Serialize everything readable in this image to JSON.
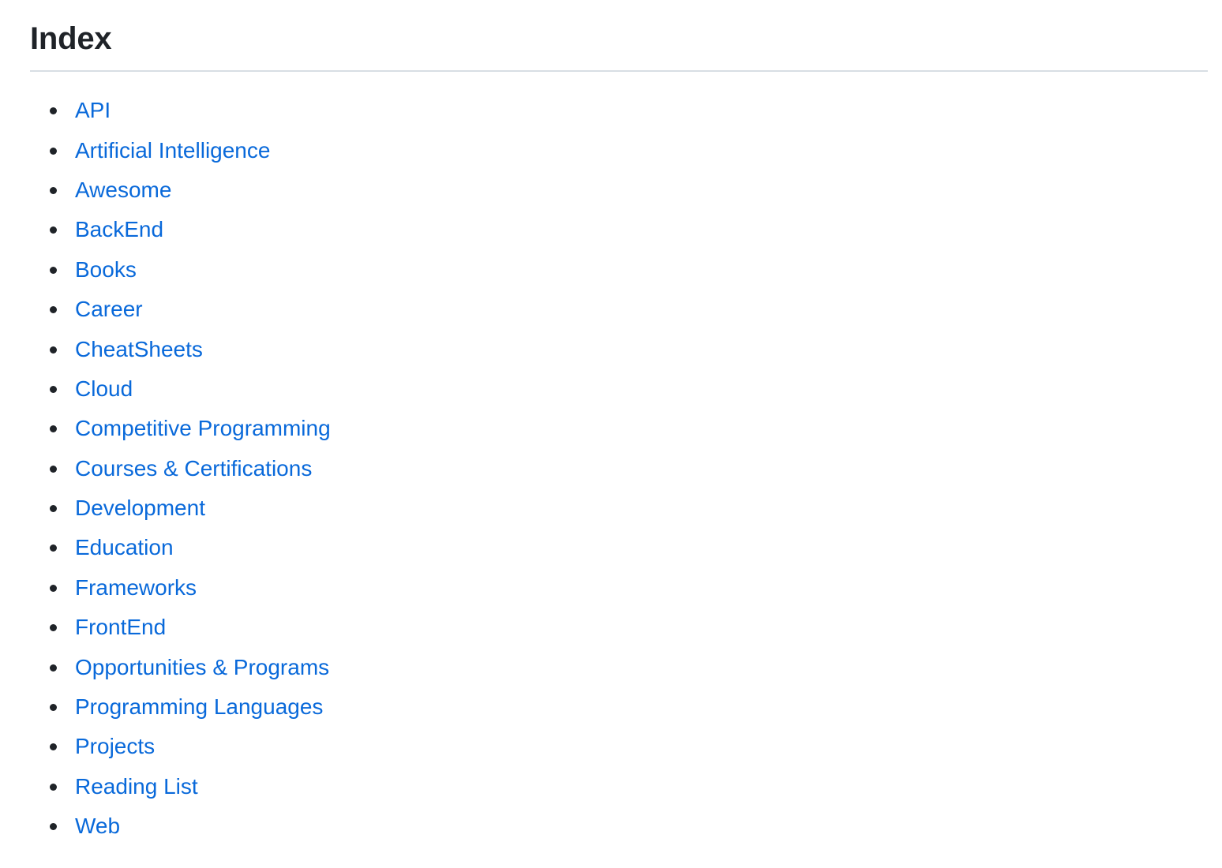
{
  "page": {
    "title": "Index"
  },
  "colors": {
    "link": "#0969da",
    "text": "#1f2328",
    "divider": "#d8dee4",
    "background": "#ffffff"
  },
  "index": {
    "items": [
      {
        "label": "API"
      },
      {
        "label": "Artificial Intelligence"
      },
      {
        "label": "Awesome"
      },
      {
        "label": "BackEnd"
      },
      {
        "label": "Books"
      },
      {
        "label": "Career"
      },
      {
        "label": "CheatSheets"
      },
      {
        "label": "Cloud"
      },
      {
        "label": "Competitive Programming"
      },
      {
        "label": "Courses & Certifications"
      },
      {
        "label": "Development"
      },
      {
        "label": "Education"
      },
      {
        "label": "Frameworks"
      },
      {
        "label": "FrontEnd"
      },
      {
        "label": "Opportunities & Programs"
      },
      {
        "label": "Programming Languages"
      },
      {
        "label": "Projects"
      },
      {
        "label": "Reading List"
      },
      {
        "label": "Web"
      }
    ]
  }
}
